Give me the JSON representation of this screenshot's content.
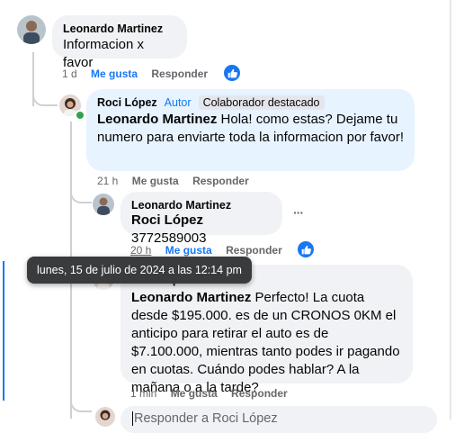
{
  "comments": [
    {
      "author": "Leonardo Martinez",
      "text": "Informacion x favor",
      "time": "1 d",
      "like_label": "Me gusta",
      "reply_label": "Responder"
    },
    {
      "author": "Roci López",
      "author_tag": "Autor",
      "author_badge": "Colaborador destacado",
      "mention": "Leonardo Martinez",
      "text": " Hola! como estas? Dejame tu numero para enviarte toda la informacion por favor!",
      "time": "21 h",
      "like_label": "Me gusta",
      "reply_label": "Responder"
    },
    {
      "author": "Leonardo Martinez",
      "mention": "Roci López",
      "text": " 3772589003",
      "more_label": "···",
      "time": "20 h",
      "like_label": "Me gusta",
      "reply_label": "Responder"
    },
    {
      "author": "Roci López",
      "mention": "Leonardo Martinez",
      "text": " Perfecto! La cuota desde $195.000. es de un CRONOS 0KM el anticipo para retirar el auto es de $7.100.000, mientras tanto podes ir pagando en cuotas. Cuándo podes hablar? A la mañana o a la tarde?",
      "time": "1 min",
      "like_label": "Me gusta",
      "reply_label": "Responder"
    }
  ],
  "tooltip": "lunes, 15 de julio de 2024 a las 12:14 pm",
  "reply_input": {
    "placeholder": "Responder a Roci López"
  },
  "colors": {
    "accent": "#1877f2",
    "bubble": "#f0f2f5",
    "bubble_highlight": "#e7f3ff",
    "online": "#31a24c"
  },
  "icons": {
    "like_badge": "thumbs-up-icon"
  }
}
